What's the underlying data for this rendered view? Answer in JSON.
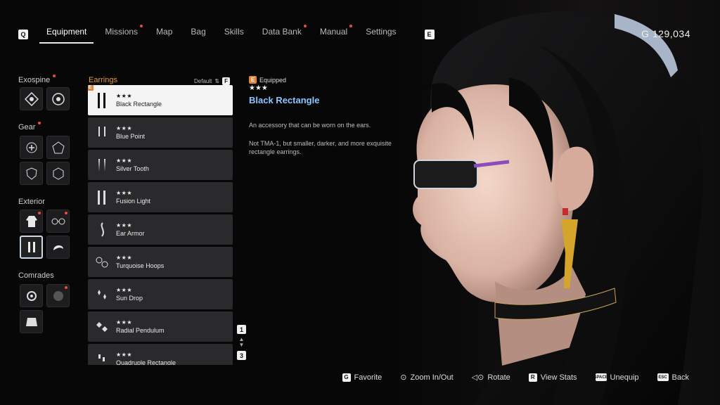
{
  "nav": {
    "left_key": "Q",
    "right_key": "E",
    "tabs": [
      {
        "label": "Equipment",
        "active": true,
        "dot": false
      },
      {
        "label": "Missions",
        "dot": true
      },
      {
        "label": "Map",
        "dot": false
      },
      {
        "label": "Bag",
        "dot": false
      },
      {
        "label": "Skills",
        "dot": false
      },
      {
        "label": "Data Bank",
        "dot": true
      },
      {
        "label": "Manual",
        "dot": true
      },
      {
        "label": "Settings",
        "dot": false
      }
    ]
  },
  "currency": "G 129,034",
  "categories": {
    "exospine": "Exospine",
    "gear": "Gear",
    "exterior": "Exterior",
    "comrades": "Comrades"
  },
  "list": {
    "title": "Earrings",
    "sort_label": "Default",
    "sort_key": "F",
    "equipped_key": "E",
    "items": [
      {
        "stars": "★★★",
        "name": "Black Rectangle"
      },
      {
        "stars": "★★★",
        "name": "Blue Point"
      },
      {
        "stars": "★★★",
        "name": "Silver Tooth"
      },
      {
        "stars": "★★★",
        "name": "Fusion Light"
      },
      {
        "stars": "★★★",
        "name": "Ear Armor"
      },
      {
        "stars": "★★★",
        "name": "Turquoise Hoops"
      },
      {
        "stars": "★★★",
        "name": "Sun Drop"
      },
      {
        "stars": "★★★",
        "name": "Radial Pendulum"
      },
      {
        "stars": "★★★",
        "name": "Quadruple Rectangle"
      }
    ],
    "page_current": "1",
    "page_total": "3"
  },
  "detail": {
    "equipped_key": "E",
    "equipped_label": "Equipped",
    "stars": "★★★",
    "name": "Black Rectangle",
    "description": "An accessory that can be worn on the ears.",
    "lore": "Not TMA-1, but smaller, darker, and more exquisite rectangle earrings."
  },
  "actions": {
    "favorite_key": "G",
    "favorite": "Favorite",
    "zoom": "Zoom In/Out",
    "rotate": "Rotate",
    "stats_key": "R",
    "stats": "View Stats",
    "unequip_key": "SPACE",
    "unequip": "Unequip",
    "back_key": "ESC",
    "back": "Back"
  },
  "colors": {
    "accent_orange": "#e5833a",
    "title_blue": "#8fc4ff",
    "notify_red": "#e0503a"
  }
}
